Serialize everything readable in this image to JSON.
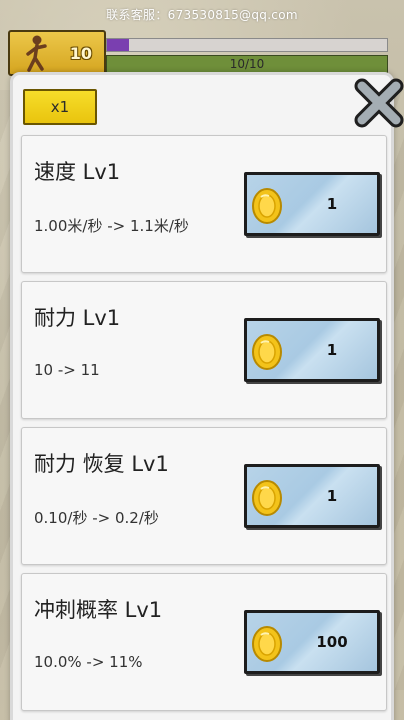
{
  "header": {
    "contact": "联系客服：673530815@qq.com",
    "level": "10",
    "progress_fraction": 0.08,
    "energy": "10/10"
  },
  "modal": {
    "multiplier": "x1",
    "close_icon": "close-x-icon",
    "upgrades": [
      {
        "title": "速度 Lv1",
        "desc": "1.00米/秒 -> 1.1米/秒",
        "cost": "1",
        "icon": "gold-coin-icon"
      },
      {
        "title": "耐力 Lv1",
        "desc": "10 -> 11",
        "cost": "1",
        "icon": "gold-coin-icon"
      },
      {
        "title": "耐力 恢复 Lv1",
        "desc": "0.10/秒 -> 0.2/秒",
        "cost": "1",
        "icon": "gold-coin-icon"
      },
      {
        "title": "冲刺概率 Lv1",
        "desc": "10.0% -> 11%",
        "cost": "100",
        "icon": "gold-coin-icon"
      }
    ]
  },
  "colors": {
    "multiplier_bg": "#f0cd1a",
    "buy_button_bg": "#aecde5",
    "progress_fill": "#7a3fb0",
    "energy_bar": "#6f8f3a"
  }
}
